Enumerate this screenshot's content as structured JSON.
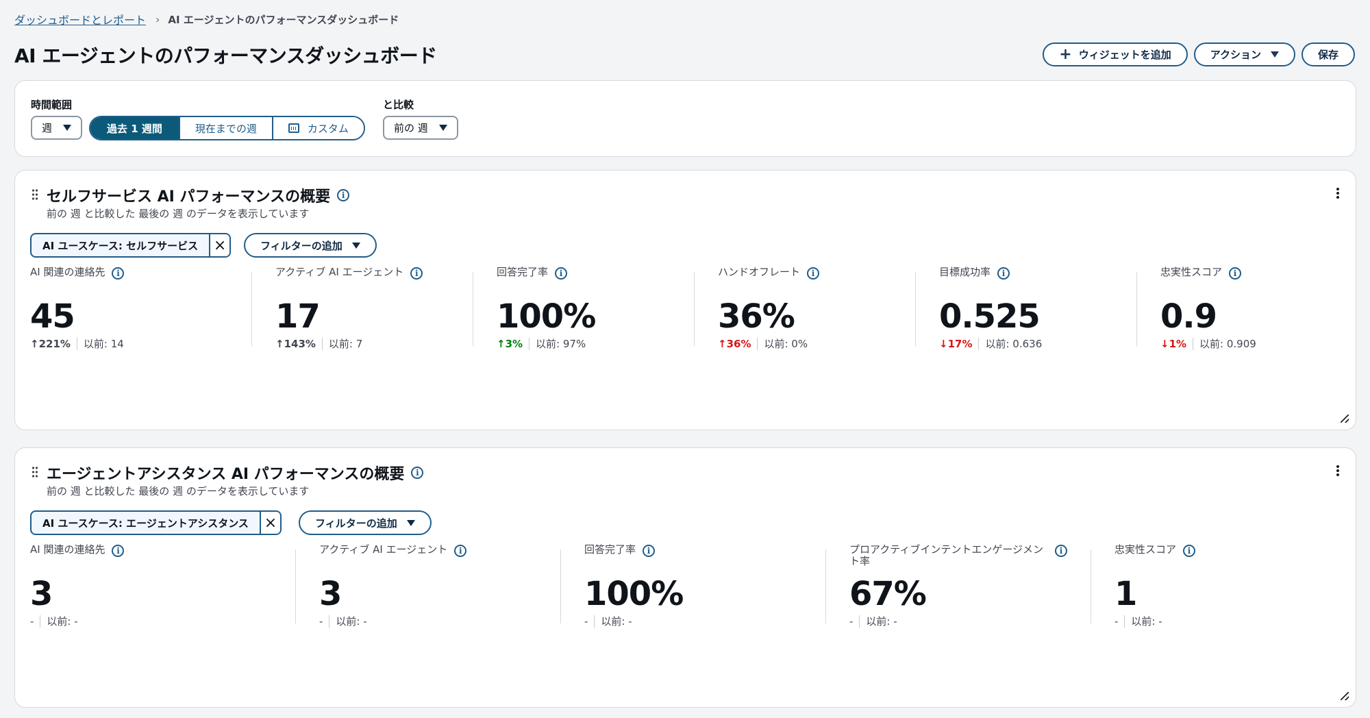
{
  "breadcrumb": {
    "parent": "ダッシュボードとレポート",
    "current": "AI エージェントのパフォーマンスダッシュボード"
  },
  "page": {
    "title": "AI エージェントのパフォーマンスダッシュボード"
  },
  "header_actions": {
    "add_widget": "ウィジェットを追加",
    "actions": "アクション",
    "save": "保存"
  },
  "filters": {
    "time_range_label": "時間範囲",
    "granularity_value": "週",
    "segments": [
      "過去 1 週間",
      "現在までの週",
      "カスタム"
    ],
    "compare_label": "と比較",
    "compare_value": "前の 週"
  },
  "widgets": [
    {
      "title": "セルフサービス AI パフォーマンスの概要",
      "subtitle": "前の 週 と比較した 最後の 週 のデータを表示しています",
      "filter_token": "AI ユースケース: セルフサービス",
      "add_filter": "フィルターの追加",
      "metrics": [
        {
          "label": "AI 関連の連絡先",
          "value": "45",
          "delta": "221%",
          "direction": "up",
          "color": "#424650",
          "previous": "以前: 14"
        },
        {
          "label": "アクティブ AI エージェント",
          "value": "17",
          "delta": "143%",
          "direction": "up",
          "color": "#424650",
          "previous": "以前: 7"
        },
        {
          "label": "回答完了率",
          "value": "100%",
          "delta": "3%",
          "direction": "up",
          "color": "#037f0c",
          "previous": "以前: 97%"
        },
        {
          "label": "ハンドオフレート",
          "value": "36%",
          "delta": "36%",
          "direction": "up",
          "color": "#d91515",
          "previous": "以前: 0%"
        },
        {
          "label": "目標成功率",
          "value": "0.525",
          "delta": "17%",
          "direction": "down",
          "color": "#d91515",
          "previous": "以前: 0.636"
        },
        {
          "label": "忠実性スコア",
          "value": "0.9",
          "delta": "1%",
          "direction": "down",
          "color": "#d91515",
          "previous": "以前: 0.909"
        }
      ]
    },
    {
      "title": "エージェントアシスタンス AI パフォーマンスの概要",
      "subtitle": "前の 週 と比較した 最後の 週 のデータを表示しています",
      "filter_token": "AI ユースケース: エージェントアシスタンス",
      "add_filter": "フィルターの追加",
      "metrics": [
        {
          "label": "AI 関連の連絡先",
          "value": "3",
          "delta": "-",
          "previous": "以前: -"
        },
        {
          "label": "アクティブ AI エージェント",
          "value": "3",
          "delta": "-",
          "previous": "以前: -"
        },
        {
          "label": "回答完了率",
          "value": "100%",
          "delta": "-",
          "previous": "以前: -"
        },
        {
          "label": "プロアクティブインテントエンゲージメント率",
          "value": "67%",
          "delta": "-",
          "previous": "以前: -"
        },
        {
          "label": "忠実性スコア",
          "value": "1",
          "delta": "-",
          "previous": "以前: -"
        }
      ]
    }
  ]
}
